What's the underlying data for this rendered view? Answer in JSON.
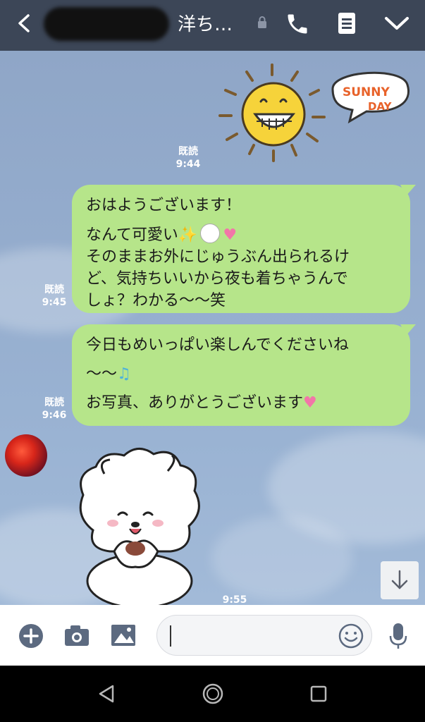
{
  "header": {
    "title": "洋ち…",
    "contact_name_redacted": true,
    "background": "#3c4657"
  },
  "chat": {
    "stickers": [
      {
        "name": "sunny-day-sticker",
        "text_line1": "SUNNY",
        "text_line2": "DAY"
      },
      {
        "name": "white-fluffy-dog-sticker"
      }
    ],
    "messages": [
      {
        "read": "既読",
        "time": "9:44",
        "type": "sticker"
      },
      {
        "read": "既読",
        "time": "9:45",
        "line1": "おはようございます！",
        "line2": "なんて可愛い",
        "line3": "そのままお外にじゅうぶん出られるけ",
        "line4": "ど、気持ちいいから夜も着ちゃうんで",
        "line5": "しょ？わかる〜〜笑"
      },
      {
        "read": "既読",
        "time": "9:46",
        "line1": "今日もめいっぱい楽しんでくださいね",
        "line2": "〜〜",
        "line3": "お写真、ありがとうございます"
      }
    ],
    "incoming_time": "9:55",
    "bubble_color": "#b6e58a"
  },
  "inputbar": {
    "placeholder": ""
  }
}
